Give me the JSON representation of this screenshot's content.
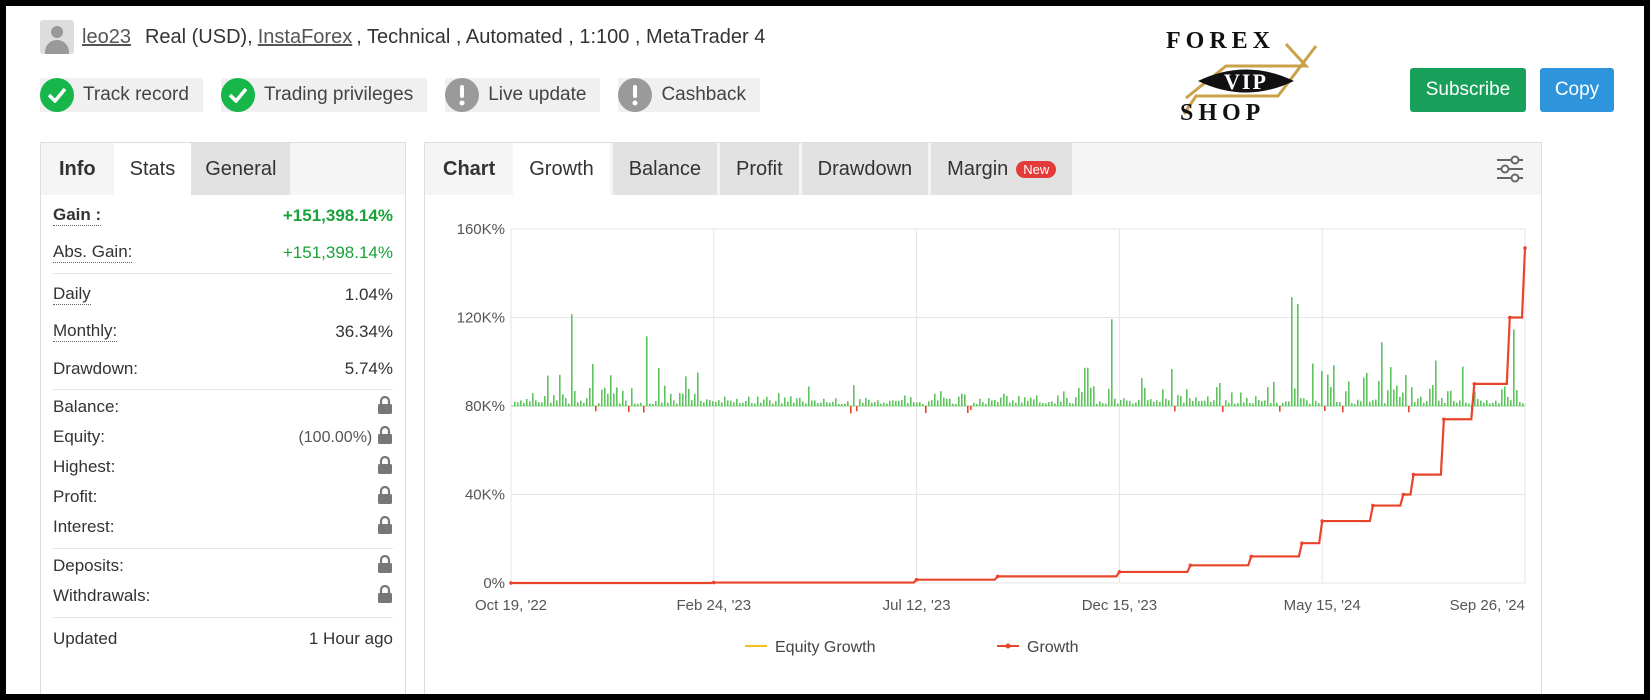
{
  "header": {
    "username": "leo23",
    "account_prefix": "Real (USD),",
    "broker": "InstaForex",
    "account_suffix": ", Technical , Automated , 1:100 , MetaTrader 4"
  },
  "badges": [
    {
      "label": "Track record",
      "status": "ok"
    },
    {
      "label": "Trading privileges",
      "status": "ok"
    },
    {
      "label": "Live update",
      "status": "warn"
    },
    {
      "label": "Cashback",
      "status": "warn"
    }
  ],
  "logo": {
    "top": "FOREX",
    "middle": "VIP",
    "bottom": "SHOP"
  },
  "buttons": {
    "subscribe": "Subscribe",
    "copy": "Copy"
  },
  "left_tabs": [
    "Info",
    "Stats",
    "General"
  ],
  "stats": {
    "gain": {
      "label": "Gain :",
      "value": "+151,398.14%"
    },
    "abs_gain": {
      "label": "Abs. Gain:",
      "value": "+151,398.14%"
    },
    "daily": {
      "label": "Daily",
      "value": "1.04%"
    },
    "monthly": {
      "label": "Monthly:",
      "value": "36.34%"
    },
    "drawdown": {
      "label": "Drawdown:",
      "value": "5.74%"
    },
    "balance": {
      "label": "Balance:"
    },
    "equity": {
      "label": "Equity:",
      "value": "(100.00%)"
    },
    "highest": {
      "label": "Highest:"
    },
    "profit": {
      "label": "Profit:"
    },
    "interest": {
      "label": "Interest:"
    },
    "deposits": {
      "label": "Deposits:"
    },
    "withdrawals": {
      "label": "Withdrawals:"
    },
    "updated": {
      "label": "Updated",
      "value": "1 Hour ago"
    }
  },
  "chart_tabs": {
    "label": "Chart",
    "tabs": [
      "Growth",
      "Balance",
      "Profit",
      "Drawdown",
      "Margin"
    ],
    "new_badge": "New"
  },
  "chart_data": {
    "type": "line",
    "title": "",
    "xlabel": "",
    "ylabel": "",
    "y_ticks": [
      "0%",
      "40K%",
      "80K%",
      "120K%",
      "160K%"
    ],
    "ylim": [
      0,
      160000
    ],
    "x_ticks": [
      "Oct 19, '22",
      "Feb 24, '23",
      "Jul 12, '23",
      "Dec 15, '23",
      "May 15, '24",
      "Sep 26, '24"
    ],
    "grid": true,
    "legend_position": "bottom",
    "series": [
      {
        "name": "Equity Growth",
        "color": "#f0c020",
        "values": []
      },
      {
        "name": "Growth",
        "color": "#e8452c",
        "x": [
          "Oct 19, '22",
          "Feb 24, '23",
          "Jul 12, '23",
          "Aug 2023",
          "Dec 15, '23",
          "Feb 2024",
          "Mar 2024",
          "Apr 2024",
          "May 15, '24",
          "Jun 2024",
          "Jul 2024",
          "Aug 2024",
          "Aug 2024",
          "Sep 2024",
          "Sep 2024",
          "Sep 26, '24"
        ],
        "values": [
          0,
          200,
          1500,
          3000,
          5000,
          8000,
          12000,
          18000,
          28000,
          35000,
          40000,
          49000,
          74000,
          90000,
          120000,
          151398
        ]
      }
    ],
    "bars_baseline": 80000,
    "bars_note_series": "daily profit bars (green positive, red negative)"
  },
  "colors": {
    "green": "#18a05a",
    "blue": "#2e95dd",
    "growth": "#e8452c",
    "bars": "#5dc45d",
    "neg_bars": "#e8452c"
  }
}
